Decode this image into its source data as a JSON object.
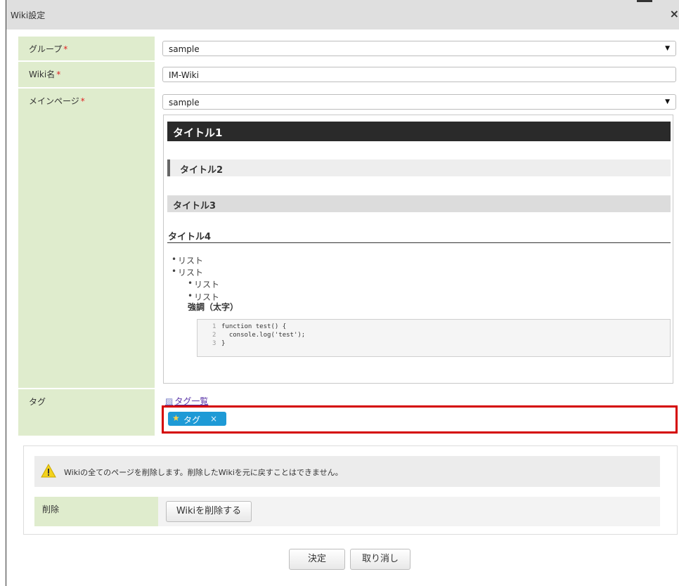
{
  "dialog": {
    "title": "Wiki設定",
    "close_icon": "×"
  },
  "form": {
    "required_mark": "*",
    "group": {
      "label": "グループ",
      "value": "sample"
    },
    "wiki_name": {
      "label": "Wiki名",
      "value": "IM-Wiki"
    },
    "main_page": {
      "label": "メインページ",
      "value": "sample"
    },
    "tag": {
      "label": "タグ",
      "list_link": "タグ一覧",
      "chips": [
        "タグ"
      ]
    }
  },
  "preview": {
    "h1": "タイトル1",
    "h2": "タイトル2",
    "h3": "タイトル3",
    "h4": "タイトル4",
    "list": [
      "リスト",
      "リスト"
    ],
    "sublist": [
      "リスト",
      "リスト"
    ],
    "strong": "強調（太字）",
    "code": {
      "line_numbers": [
        "1",
        "2",
        "3"
      ],
      "lines": [
        "function test() {",
        "  console.log('test');",
        "}"
      ]
    }
  },
  "danger": {
    "warning": "Wikiの全てのページを削除します。削除したWikiを元に戻すことはできません。",
    "label": "削除",
    "button": "Wikiを削除する"
  },
  "footer": {
    "ok": "決定",
    "cancel": "取り消し"
  },
  "colors": {
    "label_bg": "#dfeccd",
    "highlight": "#d40000",
    "chip": "#1e9ad6"
  }
}
